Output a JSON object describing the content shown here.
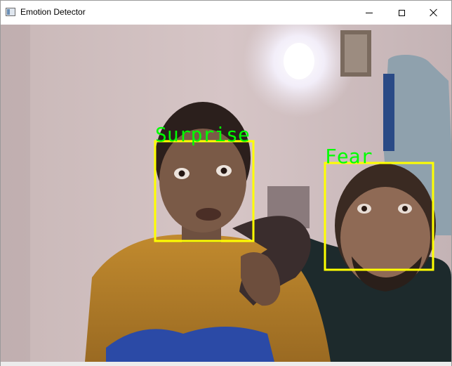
{
  "window": {
    "title": "Emotion Detector",
    "icon": "window-app-icon",
    "controls": [
      "minimize",
      "maximize",
      "close"
    ]
  },
  "camera_feed": {
    "description_icon": "camera-frame",
    "detections": [
      {
        "label": "Surprise",
        "box_color": "#ffff00",
        "label_color": "#00ff00"
      },
      {
        "label": "Fear",
        "box_color": "#ffff00",
        "label_color": "#00ff00"
      }
    ]
  }
}
